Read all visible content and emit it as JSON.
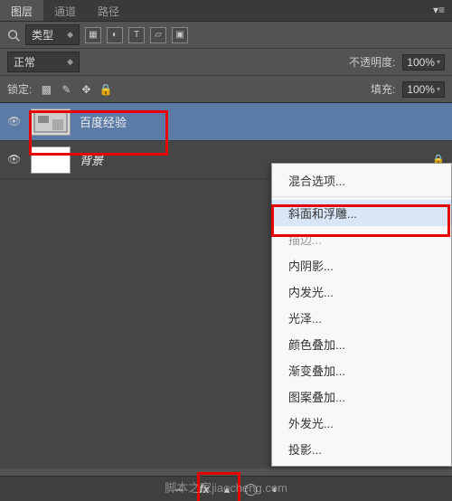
{
  "tabs": {
    "layers": "图层",
    "channels": "通道",
    "paths": "路径"
  },
  "filter": {
    "kind_label": "类型"
  },
  "blend": {
    "mode": "正常",
    "opacity_label": "不透明度:",
    "opacity_value": "100%"
  },
  "lock": {
    "label": "锁定:",
    "fill_label": "填充:",
    "fill_value": "100%"
  },
  "layers_list": [
    {
      "name": "百度经验",
      "selected": true
    },
    {
      "name": "背景",
      "selected": false,
      "locked": true
    }
  ],
  "context_menu": {
    "items": [
      {
        "label": "混合选项...",
        "state": "normal"
      },
      {
        "sep": true
      },
      {
        "label": "斜面和浮雕...",
        "state": "hover"
      },
      {
        "label": "描边...",
        "state": "disabled"
      },
      {
        "label": "内阴影...",
        "state": "normal"
      },
      {
        "label": "内发光...",
        "state": "normal"
      },
      {
        "label": "光泽...",
        "state": "normal"
      },
      {
        "label": "颜色叠加...",
        "state": "normal"
      },
      {
        "label": "渐变叠加...",
        "state": "normal"
      },
      {
        "label": "图案叠加...",
        "state": "normal"
      },
      {
        "label": "外发光...",
        "state": "normal"
      },
      {
        "label": "投影...",
        "state": "normal"
      }
    ]
  },
  "bottom": {
    "fx": "fx"
  },
  "watermark1": "jb51.net",
  "watermark2": "脚本之家jiaocheng.com"
}
